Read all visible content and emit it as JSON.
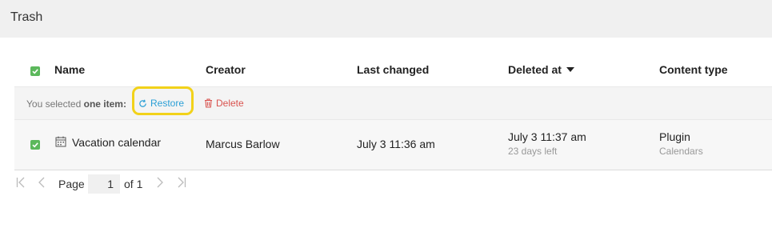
{
  "page": {
    "title": "Trash"
  },
  "table": {
    "columns": [
      "Name",
      "Creator",
      "Last changed",
      "Deleted at",
      "Content type"
    ],
    "sort_column": "Deleted at"
  },
  "selection": {
    "prefix": "You selected",
    "count_text": "one item:",
    "restore_label": "Restore",
    "delete_label": "Delete"
  },
  "rows": [
    {
      "name": "Vacation calendar",
      "creator": "Marcus Barlow",
      "last_changed": "July 3 11:36 am",
      "deleted_at": "July 3 11:37 am",
      "deleted_sub": "23 days left",
      "content_type": "Plugin",
      "content_sub": "Calendars",
      "selected": true
    }
  ],
  "pagination": {
    "page_label": "Page",
    "current_page": "1",
    "of_label": "of 1"
  },
  "colors": {
    "checkbox": "#5cb85c",
    "restore": "#2a9fd6",
    "delete": "#d9534f",
    "highlight": "#f2d21a"
  }
}
